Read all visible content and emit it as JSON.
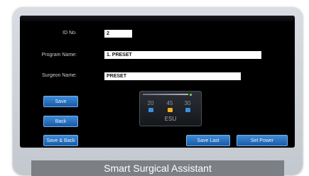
{
  "form": {
    "id_label": "ID No.",
    "id_value": "2",
    "program_label": "Program Name:",
    "program_value": "1. PRESET",
    "surgeon_label": "Surgeon Name:",
    "surgeon_value": "PRESET"
  },
  "buttons": {
    "save": "Save",
    "back": "Back",
    "save_back": "Save & Back",
    "save_last": "Save Last",
    "set_power": "Set Power"
  },
  "esu": {
    "values": [
      "20",
      "45",
      "30"
    ],
    "label": "ESU",
    "indicator_colors": [
      "#3b8fe0",
      "#f2b01e",
      "#3b8fe0"
    ]
  },
  "caption": "Smart Surgical Assistant"
}
